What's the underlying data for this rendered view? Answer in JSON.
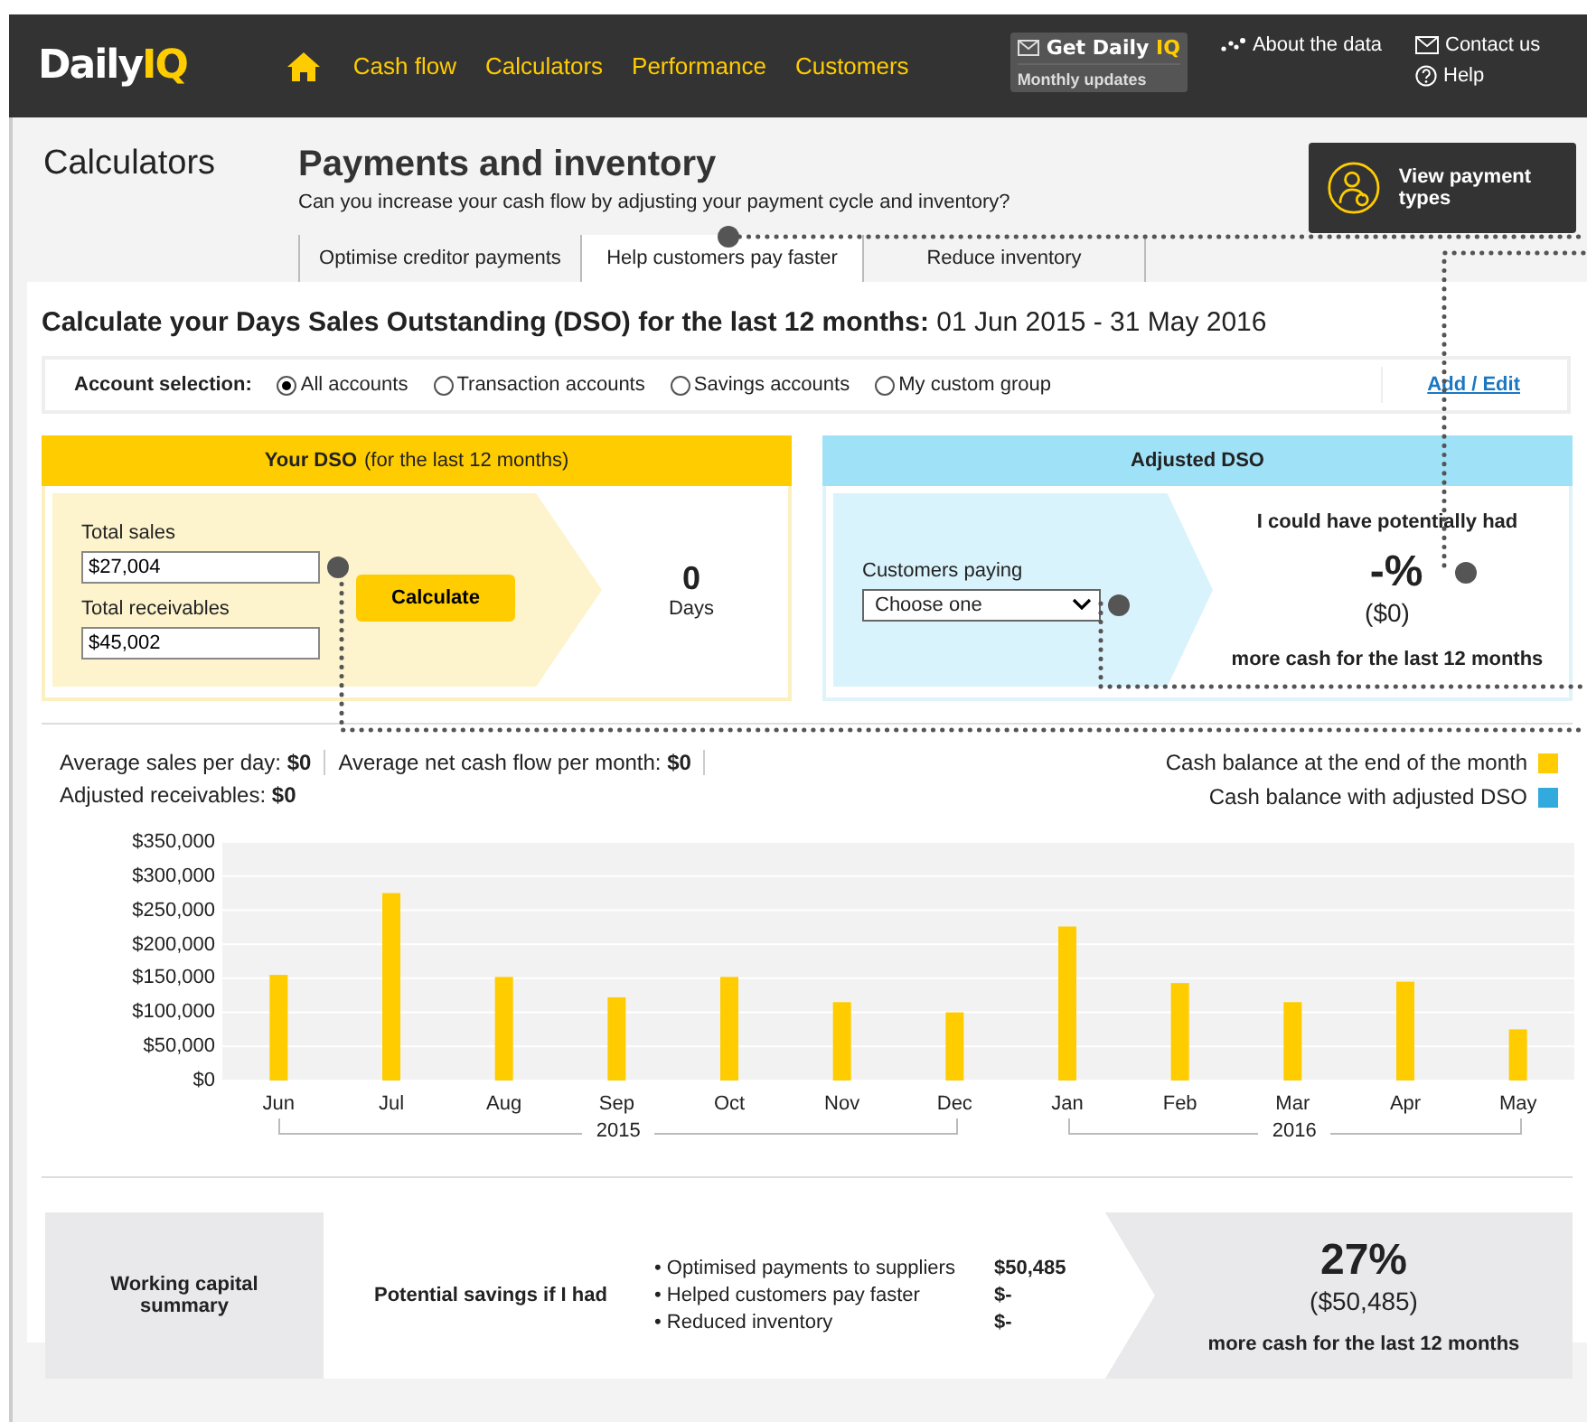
{
  "header": {
    "logo": {
      "part1": "Daily",
      "part2": "IQ"
    },
    "nav": [
      {
        "label": "Cash flow"
      },
      {
        "label": "Calculators"
      },
      {
        "label": "Performance"
      },
      {
        "label": "Customers"
      }
    ],
    "promo": {
      "title_part1": "Get Daily",
      "title_part2": "IQ",
      "subtitle": "Monthly updates"
    },
    "links": [
      {
        "label": "About the data"
      },
      {
        "label": "Contact us"
      },
      {
        "label": "Help"
      }
    ]
  },
  "section_title": "Calculators",
  "page": {
    "title": "Payments and inventory",
    "subtitle": "Can you increase your cash flow by adjusting your payment cycle and inventory?",
    "payment_button": "View payment types"
  },
  "tabs": [
    {
      "label": "Optimise creditor payments",
      "selected": false
    },
    {
      "label": "Help customers pay faster",
      "selected": true
    },
    {
      "label": "Reduce inventory",
      "selected": false
    }
  ],
  "heading": {
    "bold": "Calculate your Days Sales Outstanding (DSO) for the last 12 months:",
    "period": "01 Jun 2015 - 31 May 2016"
  },
  "account_selection": {
    "label": "Account selection:",
    "options": [
      {
        "label": "All accounts",
        "selected": true
      },
      {
        "label": "Transaction accounts",
        "selected": false
      },
      {
        "label": "Savings accounts",
        "selected": false
      },
      {
        "label": "My custom group",
        "selected": false
      }
    ],
    "link": "Add / Edit"
  },
  "your_dso": {
    "title": "**Your DSO** (for the last 12 months)",
    "sales_label": "Total sales",
    "sales_value": "$27,004",
    "receivables_label": "Total receivables",
    "receivables_value": "$45,002",
    "button": "Calculate",
    "result": "0",
    "unit": "Days"
  },
  "adjusted_dso": {
    "title": "Adjusted DSO",
    "select_label": "Customers paying",
    "select_value": "Choose one",
    "intro": "I could have potentially had",
    "percent": "-%",
    "amount": "($0)",
    "footer": "more cash for the last 12 months"
  },
  "stats": [
    {
      "label": "Average sales per day:",
      "value": "$0"
    },
    {
      "label": "Average net cash flow per month:",
      "value": "$0"
    },
    {
      "label": "Adjusted receivables:",
      "value": "$0"
    }
  ],
  "year_groups": [
    {
      "label": "2015",
      "months": [
        "Jun",
        "Jul",
        "Aug",
        "Sep",
        "Oct",
        "Nov",
        "Dec"
      ]
    },
    {
      "label": "2016",
      "months": [
        "Jan",
        "Feb",
        "Mar",
        "Apr",
        "May"
      ]
    }
  ],
  "chart_data": {
    "type": "bar",
    "series": [
      {
        "name": "Cash balance at the end of the month",
        "color": "#ffcc00",
        "values": [
          155000,
          275000,
          152000,
          122000,
          152000,
          115000,
          100000,
          226000,
          143000,
          115000,
          145000,
          75000
        ]
      },
      {
        "name": "Cash balance with adjusted DSO",
        "color": "#33aadd",
        "values": [
          null,
          null,
          null,
          null,
          null,
          null,
          null,
          null,
          null,
          null,
          null,
          null
        ]
      }
    ],
    "grid": true,
    "ylim": [
      0,
      350000
    ],
    "yticks": [
      {
        "value": 0,
        "label": "$0"
      },
      {
        "value": 50000,
        "label": "$50,000"
      },
      {
        "value": 100000,
        "label": "$100,000"
      },
      {
        "value": 150000,
        "label": "$150,000"
      },
      {
        "value": 200000,
        "label": "$200,000"
      },
      {
        "value": 250000,
        "label": "$250,000"
      },
      {
        "value": 300000,
        "label": "$300,000"
      },
      {
        "value": 350000,
        "label": "$350,000"
      }
    ]
  },
  "summary": {
    "title": "Working capital summary",
    "savings_label": "Potential savings if I had",
    "items": [
      {
        "label": "• Optimised payments to suppliers",
        "value": "$50,485"
      },
      {
        "label": "• Helped customers pay faster",
        "value": "$-"
      },
      {
        "label": "• Reduced inventory",
        "value": "$-"
      }
    ],
    "percent": "27%",
    "amount": "($50,485)",
    "footer": "more cash for the last 12 months"
  }
}
